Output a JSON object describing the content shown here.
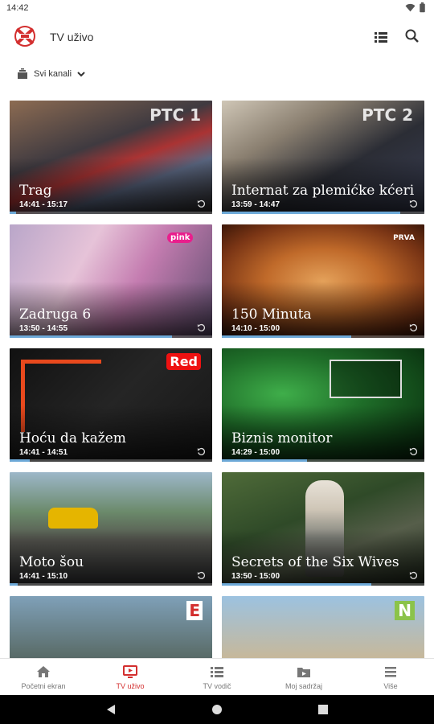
{
  "status": {
    "time": "14:42"
  },
  "header": {
    "title": "TV uživo",
    "icons": [
      "list-icon",
      "search-icon"
    ]
  },
  "filter": {
    "label": "Svi kanali",
    "icon": "channels-icon"
  },
  "cards": [
    {
      "title": "Trag",
      "time": "14:41 - 15:17",
      "channel": "РТС 1",
      "progress": 0.03
    },
    {
      "title": "Internat za plemićke kćeri",
      "time": "13:59 - 14:47",
      "channel": "РТС 2",
      "progress": 0.88
    },
    {
      "title": "Zadruga 6",
      "time": "13:50 - 14:55",
      "channel": "pink",
      "progress": 0.8
    },
    {
      "title": "150 Minuta",
      "time": "14:10 - 15:00",
      "channel": "PRVA",
      "progress": 0.64
    },
    {
      "title": "Hoću da kažem",
      "time": "14:41 - 14:51",
      "channel": "Red",
      "progress": 0.1
    },
    {
      "title": "Biznis monitor",
      "time": "14:29 - 15:00",
      "channel": "",
      "progress": 0.42
    },
    {
      "title": "Moto šou",
      "time": "14:41 - 15:10",
      "channel": "",
      "progress": 0.04
    },
    {
      "title": "Secrets of the Six Wives",
      "time": "13:50 - 15:00",
      "channel": "",
      "progress": 0.74
    },
    {
      "title": "",
      "time": "",
      "channel": "E",
      "progress": 0
    },
    {
      "title": "",
      "time": "",
      "channel": "N",
      "progress": 0
    }
  ],
  "nav": [
    {
      "label": "Početni ekran",
      "icon": "home-icon",
      "active": false
    },
    {
      "label": "TV uživo",
      "icon": "tv-icon",
      "active": true
    },
    {
      "label": "TV vodič",
      "icon": "guide-icon",
      "active": false
    },
    {
      "label": "Moj sadržaj",
      "icon": "folder-icon",
      "active": false
    },
    {
      "label": "Više",
      "icon": "menu-icon",
      "active": false
    }
  ],
  "colors": {
    "accent": "#d32f2f",
    "progress": "#6da9d8"
  }
}
